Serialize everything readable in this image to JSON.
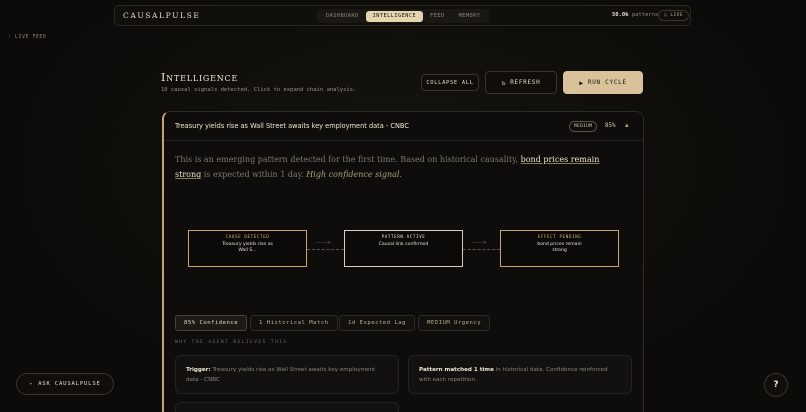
{
  "nav": {
    "brand": "CAUSALPULSE",
    "tabs": [
      {
        "label": "DASHBOARD",
        "active": false
      },
      {
        "label": "INTELLIGENCE",
        "active": true
      },
      {
        "label": "FEED",
        "active": false
      },
      {
        "label": "MEMORY",
        "active": false
      }
    ],
    "patterns_value": "50.0k",
    "patterns_label": "patterns",
    "live_label": "LIVE",
    "live_icon": "signal-dot-icon"
  },
  "livefeed": {
    "label": "LIVE FEED",
    "icon": "chevron-left-icon"
  },
  "header": {
    "title": "Intelligence",
    "subtitle": "10 causal signals detected. Click to expand chain analysis.",
    "collapse_label": "COLLAPSE ALL",
    "refresh_label": "REFRESH",
    "refresh_icon": "refresh-icon",
    "run_label": "RUN CYCLE",
    "run_icon": "play-icon"
  },
  "signal": {
    "title": "Treasury yields rise as Wall Street awaits key employment data - CNBC",
    "urgency_badge": "MEDIUM",
    "confidence_pct": "85%",
    "collapse_icon": "chevron-up-icon",
    "narrative": {
      "part1": "This is an emerging pattern detected for the first time. Based on historical causality, ",
      "highlight": "bond prices remain strong",
      "part2": " is expected within 1 day. ",
      "confidence_note": "High confidence signal."
    },
    "chain": [
      {
        "header": "CAUSE DETECTED",
        "text": "Treasury yields rise as Wall S..."
      },
      {
        "header": "PATTERN ACTIVE",
        "text": "Causal link confirmed"
      },
      {
        "header": "EFFECT PENDING",
        "text": "bond prices remain strong"
      }
    ],
    "arrow_glyph": "----->",
    "stats": [
      "85% Confidence",
      "1 Historical Match",
      "1d Expected Lag",
      "MEDIUM Urgency"
    ],
    "why_label": "WHY THE AGENT BELIEVES THIS",
    "reasons": {
      "trigger_label": "Trigger:",
      "trigger_text": " Treasury yields rise as Wall Street awaits key employment data - CNBC",
      "match_label": "Pattern matched 1 time",
      "match_text": " in historical data. Confidence reinforced with each repetition."
    }
  },
  "ask": {
    "label": "ASK CAUSALPULSE",
    "icon": "sparkle-icon"
  },
  "help": {
    "label": "?"
  }
}
